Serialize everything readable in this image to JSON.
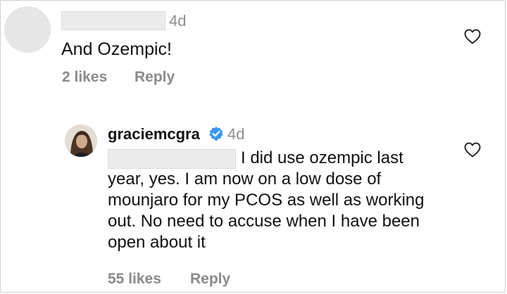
{
  "comments": [
    {
      "time": "4d",
      "text": "And Ozempic!",
      "likes": "2 likes",
      "reply_label": "Reply"
    },
    {
      "username": "graciemcgra",
      "verified": true,
      "time": "4d",
      "text": "I did use ozempic last year, yes. I am now on a low dose of mounjaro for my PCOS as well as working out. No need to accuse when I have been open about it",
      "likes": "55 likes",
      "reply_label": "Reply"
    }
  ],
  "icons": {
    "like": "heart-outline-icon",
    "verified": "verified-badge-icon"
  },
  "colors": {
    "verified_blue": "#3897f0",
    "muted_text": "#8e8e8e"
  }
}
